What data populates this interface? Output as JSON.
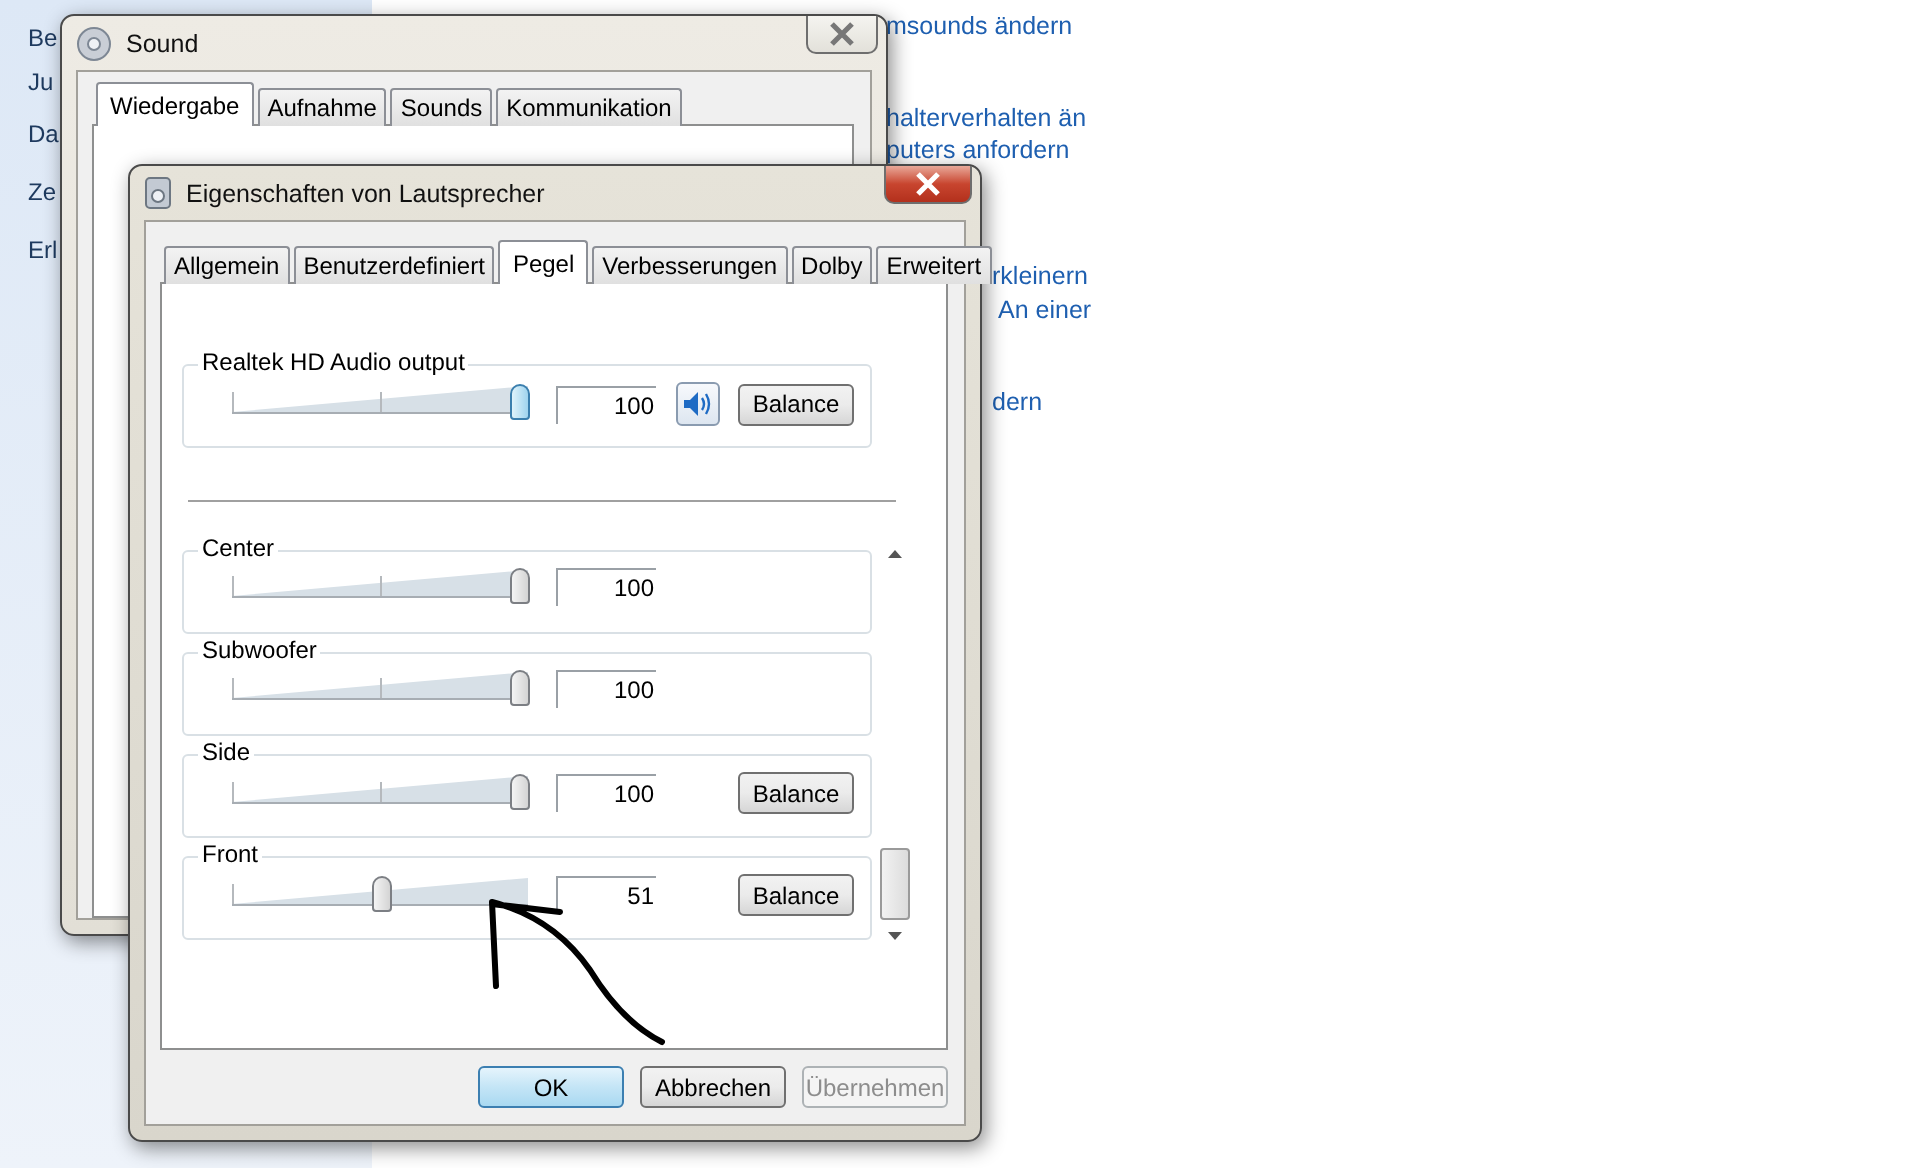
{
  "background": {
    "sidebar_items": [
      "Be",
      "Ju",
      "Da",
      "Ze",
      "Erl"
    ],
    "links": [
      "msounds ändern",
      "halterverhalten än",
      "puters anfordern",
      "rkleinern",
      "An einer",
      "dern"
    ]
  },
  "sound_window": {
    "title": "Sound",
    "tabs": [
      {
        "label": "Wiedergabe",
        "selected": true
      },
      {
        "label": "Aufnahme",
        "selected": false
      },
      {
        "label": "Sounds",
        "selected": false
      },
      {
        "label": "Kommunikation",
        "selected": false
      }
    ]
  },
  "properties_window": {
    "title": "Eigenschaften von Lautsprecher",
    "tabs": [
      {
        "label": "Allgemein",
        "selected": false
      },
      {
        "label": "Benutzerdefiniert",
        "selected": false
      },
      {
        "label": "Pegel",
        "selected": true
      },
      {
        "label": "Verbesserungen",
        "selected": false
      },
      {
        "label": "Dolby",
        "selected": false
      },
      {
        "label": "Erweitert",
        "selected": false
      }
    ],
    "master": {
      "name": "Realtek HD Audio output",
      "level": 1,
      "value": "100",
      "focused": true,
      "muted": false,
      "balance": "Balance"
    },
    "channels": [
      {
        "name": "Center",
        "level": 1,
        "value": "100",
        "focused": false
      },
      {
        "name": "Subwoofer",
        "level": 1,
        "value": "100",
        "focused": false
      },
      {
        "name": "Side",
        "level": 1,
        "value": "100",
        "focused": false,
        "balance": "Balance"
      },
      {
        "name": "Front",
        "level": 0.51,
        "value": "51",
        "focused": false,
        "balance": "Balance"
      }
    ],
    "buttons": [
      {
        "label": "OK",
        "default": true,
        "disabled": false
      },
      {
        "label": "Abbrechen",
        "default": false,
        "disabled": false
      },
      {
        "label": "Übernehmen",
        "default": false,
        "disabled": true
      }
    ]
  }
}
